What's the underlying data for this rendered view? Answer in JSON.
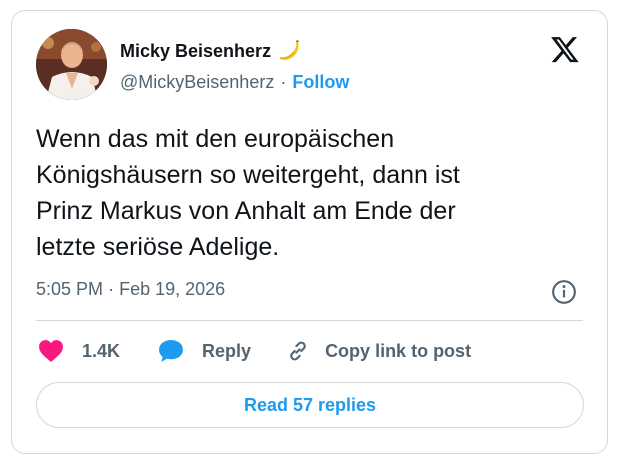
{
  "author": {
    "name": "Micky Beisenherz",
    "name_emoji_icon": "banana-icon",
    "handle": "@MickyBeisenherz",
    "separator": "·",
    "follow_label": "Follow"
  },
  "brand_icon": "x-logo-icon",
  "tweet": {
    "lines": [
      "Wenn das mit den europäischen",
      "Königshäusern so weitergeht, dann ist",
      "Prinz Markus von Anhalt am Ende der",
      "letzte seriöse Adelige."
    ],
    "time": "5:05 PM",
    "separator": "·",
    "date": "Feb 19, 2026"
  },
  "actions": {
    "like_count": "1.4K",
    "reply_label": "Reply",
    "copy_label": "Copy link to post"
  },
  "read_replies_label": "Read 57 replies",
  "colors": {
    "accent": "#1d9bf0",
    "like": "#f91880",
    "text": "#0f1419",
    "muted": "#536471",
    "border": "#cfd9de"
  }
}
